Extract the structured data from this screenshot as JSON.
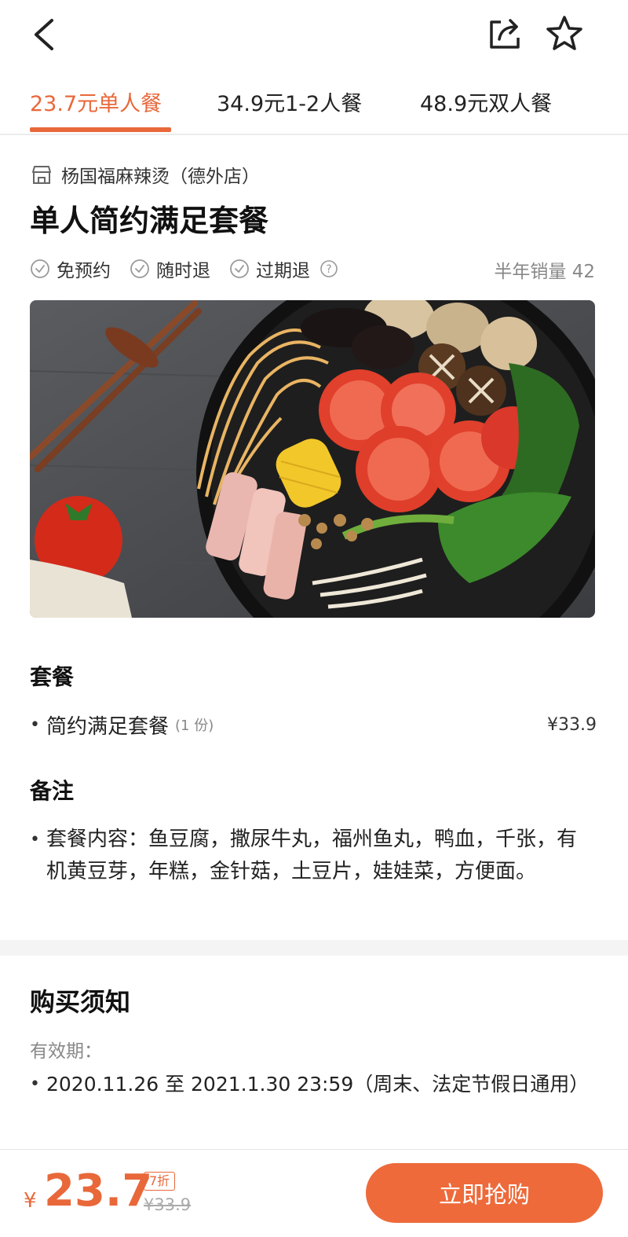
{
  "tabs": [
    {
      "label": "23.7元单人餐",
      "active": true
    },
    {
      "label": "34.9元1-2人餐",
      "active": false
    },
    {
      "label": "48.9元双人餐",
      "active": false
    }
  ],
  "shop": {
    "name": "杨国福麻辣烫（德外店）",
    "icon": "shop-icon"
  },
  "title": "单人简约满足套餐",
  "tags": [
    "免预约",
    "随时退",
    "过期退"
  ],
  "sales": "半年销量 42",
  "package": {
    "heading": "套餐",
    "items": [
      {
        "name": "简约满足套餐",
        "qty": "(1 份)",
        "price": "¥33.9"
      }
    ]
  },
  "notes": {
    "heading": "备注",
    "text": "套餐内容：鱼豆腐，撒尿牛丸，福州鱼丸，鸭血，千张，有机黄豆芽，年糕，金针菇，土豆片，娃娃菜，方便面。"
  },
  "notice": {
    "heading": "购买须知",
    "valid_label": "有效期：",
    "valid_text": "2020.11.26 至 2021.1.30 23:59（周末、法定节假日通用）"
  },
  "bottom": {
    "currency": "¥",
    "price": "23.7",
    "discount": "7折",
    "original": "¥33.9",
    "buy_label": "立即抢购"
  },
  "colors": {
    "accent": "#e8683a",
    "button": "#ee6a3a"
  }
}
